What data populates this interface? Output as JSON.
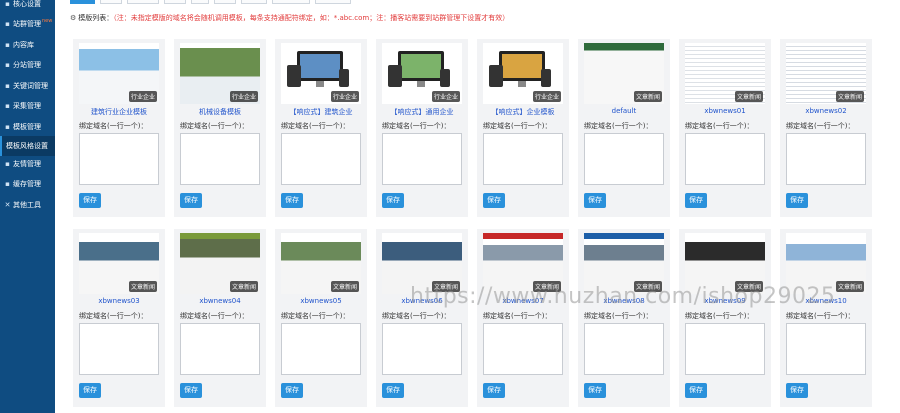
{
  "sidebar": {
    "items": [
      {
        "label": "核心设置",
        "icon": "home-icon"
      },
      {
        "label": "站群管理",
        "icon": "sites-icon",
        "badge": "new"
      },
      {
        "label": "内容库",
        "icon": "database-icon"
      },
      {
        "label": "分站管理",
        "icon": "branch-icon"
      },
      {
        "label": "关键词管理",
        "icon": "key-icon"
      },
      {
        "label": "采集管理",
        "icon": "collect-icon"
      },
      {
        "label": "模板管理",
        "icon": "template-icon"
      },
      {
        "label": "模板风格设置",
        "icon": "style-icon"
      },
      {
        "label": "友情管理",
        "icon": "link-icon"
      },
      {
        "label": "缓存管理",
        "icon": "cache-icon"
      },
      {
        "label": "其他工具",
        "icon": "tools-icon"
      }
    ]
  },
  "notice": {
    "prefix": "模版列表：",
    "note": "（注：未指定模版的域名将会随机调用模板，每条支持通配符绑定，如：*.abc.com；注：播客站需要到站群管理下设置才有效）"
  },
  "cards": [
    {
      "name": "建筑行业企业模板",
      "badge": "行业企业",
      "label": "绑定域名(一行一个)：",
      "save": "保存"
    },
    {
      "name": "机械设备模板",
      "badge": "行业企业",
      "label": "绑定域名(一行一个)：",
      "save": "保存"
    },
    {
      "name": "【响应式】建筑企业",
      "badge": "行业企业",
      "label": "绑定域名(一行一个)：",
      "save": "保存"
    },
    {
      "name": "【响应式】通用企业",
      "badge": "行业企业",
      "label": "绑定域名(一行一个)：",
      "save": "保存"
    },
    {
      "name": "【响应式】企业模板",
      "badge": "行业企业",
      "label": "绑定域名(一行一个)：",
      "save": "保存"
    },
    {
      "name": "default",
      "badge": "文章新闻",
      "label": "绑定域名(一行一个)：",
      "save": "保存"
    },
    {
      "name": "xbwnews01",
      "badge": "文章新闻",
      "label": "绑定域名(一行一个)：",
      "save": "保存"
    },
    {
      "name": "xbwnews02",
      "badge": "文章新闻",
      "label": "绑定域名(一行一个)：",
      "save": "保存"
    },
    {
      "name": "xbwnews03",
      "badge": "文章新闻",
      "label": "绑定域名(一行一个)：",
      "save": "保存"
    },
    {
      "name": "xbwnews04",
      "badge": "文章新闻",
      "label": "绑定域名(一行一个)：",
      "save": "保存"
    },
    {
      "name": "xbwnews05",
      "badge": "文章新闻",
      "label": "绑定域名(一行一个)：",
      "save": "保存"
    },
    {
      "name": "xbwnews06",
      "badge": "文章新闻",
      "label": "绑定域名(一行一个)：",
      "save": "保存"
    },
    {
      "name": "xbwnews07",
      "badge": "文章新闻",
      "label": "绑定域名(一行一个)：",
      "save": "保存"
    },
    {
      "name": "xbwnews08",
      "badge": "文章新闻",
      "label": "绑定域名(一行一个)：",
      "save": "保存"
    },
    {
      "name": "xbwnews09",
      "badge": "文章新闻",
      "label": "绑定域名(一行一个)：",
      "save": "保存"
    },
    {
      "name": "xbwnews10",
      "badge": "文章新闻",
      "label": "绑定域名(一行一个)：",
      "save": "保存"
    }
  ],
  "watermark": "https://www.huzhan.com/ishop29025"
}
